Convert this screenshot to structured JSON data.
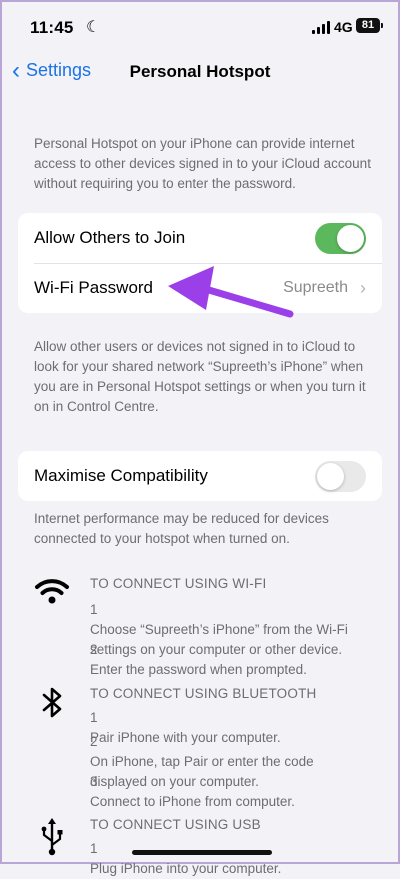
{
  "status": {
    "time": "11:45",
    "network": "4G",
    "battery": "81"
  },
  "nav": {
    "back_label": "Settings",
    "title": "Personal Hotspot"
  },
  "intro_text": "Personal Hotspot on your iPhone can provide internet access to other devices signed in to your iCloud account without requiring you to enter the password.",
  "group1": {
    "allow_label": "Allow Others to Join",
    "allow_on": true,
    "wifi_label": "Wi-Fi Password",
    "wifi_value": "Supreeth"
  },
  "allow_note": "Allow other users or devices not signed in to iCloud to look for your shared network “Supreeth’s iPhone” when you are in Personal Hotspot settings or when you turn it on in Control Centre.",
  "group2": {
    "maximise_label": "Maximise Compatibility",
    "maximise_on": false
  },
  "maximise_note": "Internet performance may be reduced for devices connected to your hotspot when turned on.",
  "connect": {
    "wifi": {
      "heading": "TO CONNECT USING WI-FI",
      "steps": [
        {
          "n": "1",
          "text": "Choose “Supreeth’s iPhone” from the Wi-Fi settings on your computer or other device."
        },
        {
          "n": "2",
          "text": "Enter the password when prompted."
        }
      ]
    },
    "bluetooth": {
      "heading": "TO CONNECT USING BLUETOOTH",
      "steps": [
        {
          "n": "1",
          "text": "Pair iPhone with your computer."
        },
        {
          "n": "2",
          "text": "On iPhone, tap Pair or enter the code displayed on your computer."
        },
        {
          "n": "3",
          "text": "Connect to iPhone from computer."
        }
      ]
    },
    "usb": {
      "heading": "TO CONNECT USING USB",
      "steps": [
        {
          "n": "1",
          "text": "Plug iPhone into your computer."
        }
      ]
    }
  },
  "colors": {
    "accent": "#1a73e8",
    "toggle_on": "#5cb85c",
    "annotation_arrow": "#9b3fe8"
  }
}
